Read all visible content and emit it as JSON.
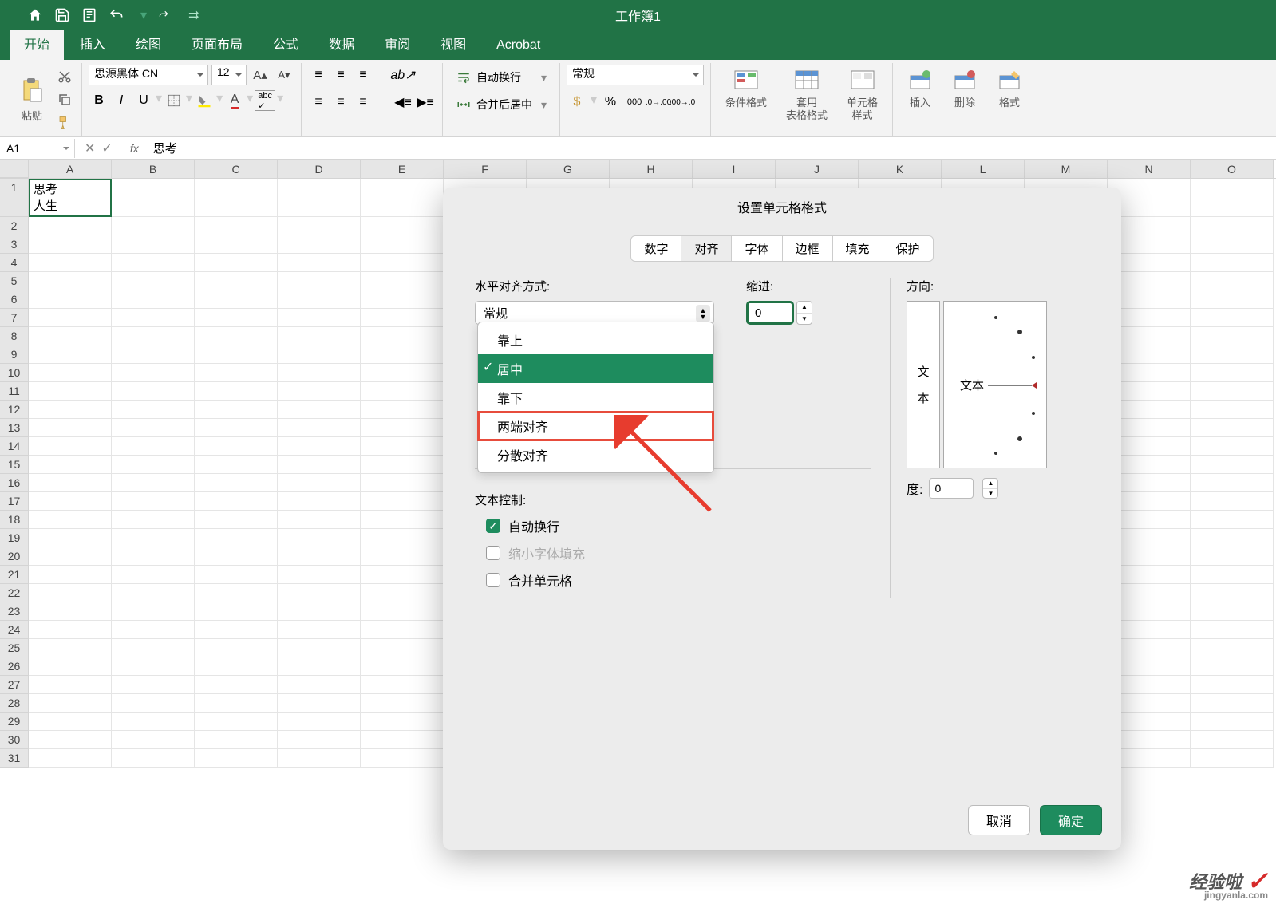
{
  "titlebar": {
    "title": "工作簿1"
  },
  "ribbon_tabs": [
    "开始",
    "插入",
    "绘图",
    "页面布局",
    "公式",
    "数据",
    "审阅",
    "视图",
    "Acrobat"
  ],
  "ribbon": {
    "paste": "粘贴",
    "font_name": "思源黑体 CN",
    "font_size": "12",
    "wrap": "自动换行",
    "merge": "合并后居中",
    "number_format": "常规",
    "cond_fmt": "条件格式",
    "table_fmt": "套用\n表格格式",
    "cell_style": "单元格\n样式",
    "insert": "插入",
    "delete": "删除",
    "format": "格式"
  },
  "formula": {
    "name_box": "A1",
    "fx": "fx",
    "value": "思考"
  },
  "columns": [
    "A",
    "B",
    "C",
    "D",
    "E",
    "F",
    "G",
    "H",
    "I",
    "J",
    "K",
    "L",
    "M",
    "N",
    "O"
  ],
  "row_count": 31,
  "cell_a1_line1": "思考",
  "cell_a1_line2": "人生",
  "dialog": {
    "title": "设置单元格格式",
    "tabs": [
      "数字",
      "对齐",
      "字体",
      "边框",
      "填充",
      "保护"
    ],
    "active_tab": 1,
    "h_align_label": "水平对齐方式:",
    "h_align_value": "常规",
    "indent_label": "缩进:",
    "indent_value": "0",
    "orient_label": "方向:",
    "orient_text": "文本",
    "orient_text_v1": "文",
    "orient_text_v2": "本",
    "degree_label": "度:",
    "degree_value": "0",
    "text_ctrl_label": "文本控制:",
    "wrap_text": "自动换行",
    "shrink": "缩小字体填充",
    "merge": "合并单元格",
    "cancel": "取消",
    "ok": "确定"
  },
  "dropdown": {
    "items": [
      "靠上",
      "居中",
      "靠下",
      "两端对齐",
      "分散对齐"
    ],
    "selected": 1,
    "highlighted": 3
  },
  "watermark": {
    "brand": "经验啦",
    "url": "jingyanla.com"
  }
}
